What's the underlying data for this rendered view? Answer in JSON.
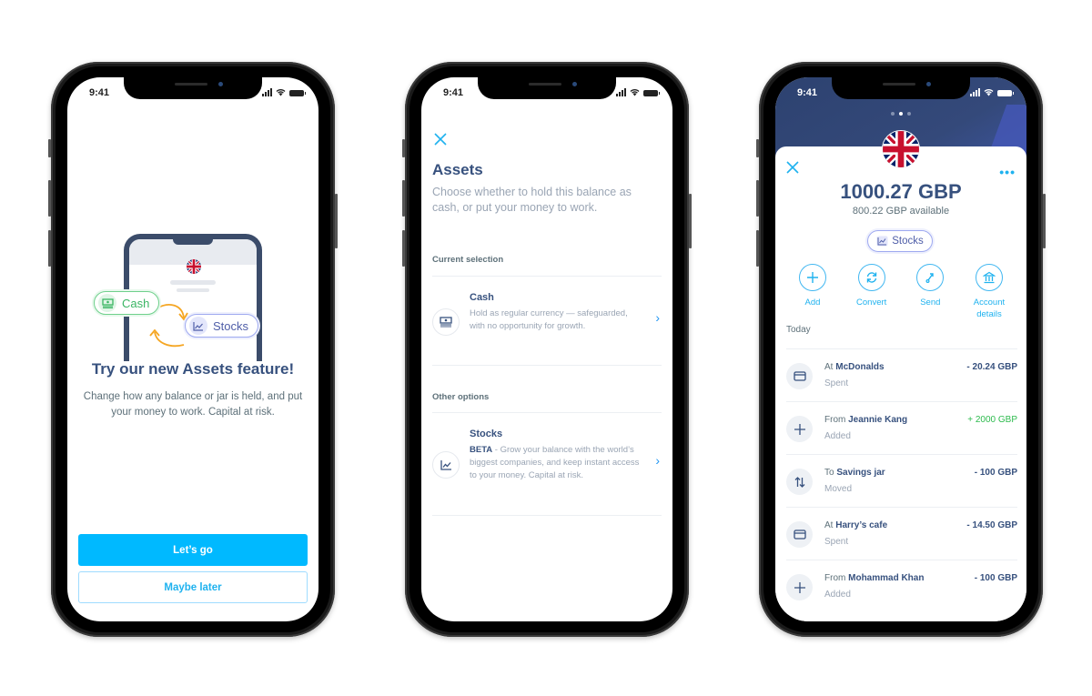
{
  "status_bar": {
    "time": "9:41"
  },
  "phone1": {
    "illustration": {
      "cash_label": "Cash",
      "stocks_label": "Stocks"
    },
    "title": "Try our new Assets feature!",
    "body": "Change how any balance or jar is held, and put your money to work. Capital at risk.",
    "primary_button": "Let’s go",
    "secondary_button": "Maybe later"
  },
  "phone2": {
    "title": "Assets",
    "subtitle": "Choose whether to hold this balance as cash, or put your money to work.",
    "current_selection_label": "Current selection",
    "other_options_label": "Other options",
    "options": [
      {
        "title": "Cash",
        "icon": "cash-icon",
        "badge": "",
        "description": "Hold as regular currency — safeguarded, with no opportunity for growth."
      },
      {
        "title": "Stocks",
        "icon": "chart-line-icon",
        "badge": "BETA",
        "description": " - Grow your balance with the world’s biggest companies, and keep instant access to your money. Capital at risk."
      }
    ]
  },
  "phone3": {
    "page_indicator": {
      "total": 3,
      "active": 2
    },
    "balance": "1000.27 GBP",
    "available": "800.22 GBP available",
    "asset_chip": "Stocks",
    "actions": [
      {
        "label": "Add",
        "icon": "plus-icon"
      },
      {
        "label": "Convert",
        "icon": "convert-icon"
      },
      {
        "label": "Send",
        "icon": "send-icon"
      },
      {
        "label": "Account details",
        "icon": "bank-icon"
      }
    ],
    "section_label": "Today",
    "transactions": [
      {
        "prefix": "At",
        "name": "McDonalds",
        "status": "Spent",
        "amount": "- 20.24 GBP",
        "positive": false,
        "icon": "card-icon"
      },
      {
        "prefix": "From",
        "name": "Jeannie Kang",
        "status": "Added",
        "amount": "+ 2000 GBP",
        "positive": true,
        "icon": "plus-icon"
      },
      {
        "prefix": "To",
        "name": "Savings jar",
        "status": "Moved",
        "amount": "- 100 GBP",
        "positive": false,
        "icon": "transfer-arrows-icon"
      },
      {
        "prefix": "At",
        "name": "Harry’s cafe",
        "status": "Spent",
        "amount": "- 14.50 GBP",
        "positive": false,
        "icon": "card-icon"
      },
      {
        "prefix": "From",
        "name": "Mohammad Khan",
        "status": "Added",
        "amount": "- 100 GBP",
        "positive": false,
        "icon": "plus-icon"
      }
    ]
  },
  "colors": {
    "primary": "#00b9ff",
    "text_dark": "#37517e",
    "text_muted": "#9aa5b4",
    "positive": "#2ebb4e",
    "header_navy": "#2d4270",
    "cash_green": "#3ab563",
    "stocks_purple": "#4f5ea8"
  }
}
